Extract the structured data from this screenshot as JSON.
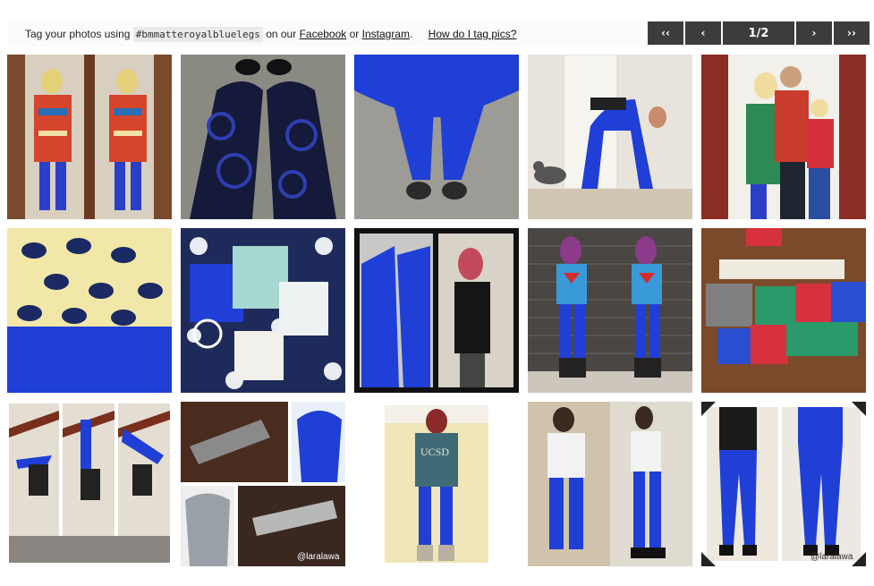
{
  "header": {
    "tag_prefix": "Tag your photos using",
    "hashtag": "#bmmatteroyalbluelegs",
    "on_our": "on our",
    "facebook": "Facebook",
    "or": "or",
    "instagram": "Instagram",
    "period": ".",
    "how_link": "How do I tag pics?"
  },
  "pager": {
    "first": "‹‹",
    "prev": "‹",
    "page": "1/2",
    "next": "›",
    "last": "››"
  },
  "gallery": {
    "watermark_1": "@laralawa",
    "watermark_2": "@laralawa"
  },
  "colors": {
    "royal_blue": "#1f3fd6",
    "pager_bg": "#3c3c3c"
  }
}
